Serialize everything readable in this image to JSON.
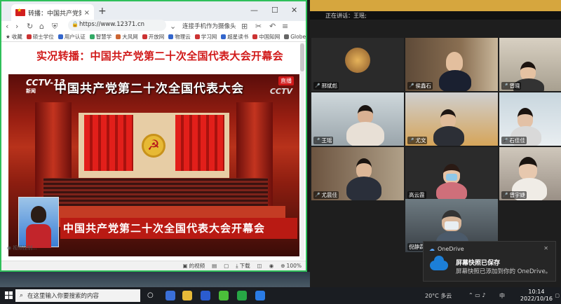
{
  "browser": {
    "tab_title": "转播：中国共产党第二十次全",
    "tab_close": "×",
    "new_tab": "+",
    "window_controls": [
      "—",
      "☐",
      "✕"
    ],
    "url": "https://www.12371.cn",
    "search_hint": "连接手机作为摄像头",
    "bookmarks_label": "收藏",
    "bookmarks": [
      {
        "label": "硕士学位",
        "color": "#c33"
      },
      {
        "label": "用户认证",
        "color": "#36c"
      },
      {
        "label": "智慧学",
        "color": "#3a6"
      },
      {
        "label": "大风网",
        "color": "#c63"
      },
      {
        "label": "开放网",
        "color": "#c33"
      },
      {
        "label": "物理云",
        "color": "#36c"
      },
      {
        "label": "学习网",
        "color": "#c33"
      },
      {
        "label": "超星读书",
        "color": "#36c"
      },
      {
        "label": "中国知网",
        "color": "#c33"
      },
      {
        "label": "Globe",
        "color": "#666"
      }
    ],
    "page_headline": "实况转播：中国共产党第二十次全国代表大会开幕会",
    "video": {
      "channel": "CCTV-13",
      "channel_sub": "新闻",
      "top_title": "中国共产党第二十次全国代表大会",
      "live_badge": "直播",
      "watermark": "CCTV",
      "lower_title": "中国共产党第二十次全国代表大会开幕会"
    },
    "caption": "视频控制...",
    "status_items": [
      "的视频",
      "",
      "",
      "下载",
      "",
      "",
      "100%"
    ]
  },
  "meeting": {
    "speaking_label": "正在讲话：王瑶;",
    "participants": [
      {
        "name": "邢斌彪"
      },
      {
        "name": "侯鑫石"
      },
      {
        "name": "曾晓"
      },
      {
        "name": "王瑶"
      },
      {
        "name": "尤文"
      },
      {
        "name": "石佳佳"
      },
      {
        "name": "尤晨佳"
      },
      {
        "name": "高云霞"
      },
      {
        "name": "曾宇婕"
      },
      {
        "name": "倪静霖"
      }
    ]
  },
  "toast": {
    "app": "OneDrive",
    "close": "✕",
    "title": "屏幕快照已保存",
    "body": "屏幕快照已添加到你的 OneDrive。"
  },
  "taskbar": {
    "search_placeholder": "在这里输入你要搜索的内容",
    "weather": "20°C 多云",
    "ime": "中",
    "time": "10:14",
    "date": "2022/10/16"
  }
}
